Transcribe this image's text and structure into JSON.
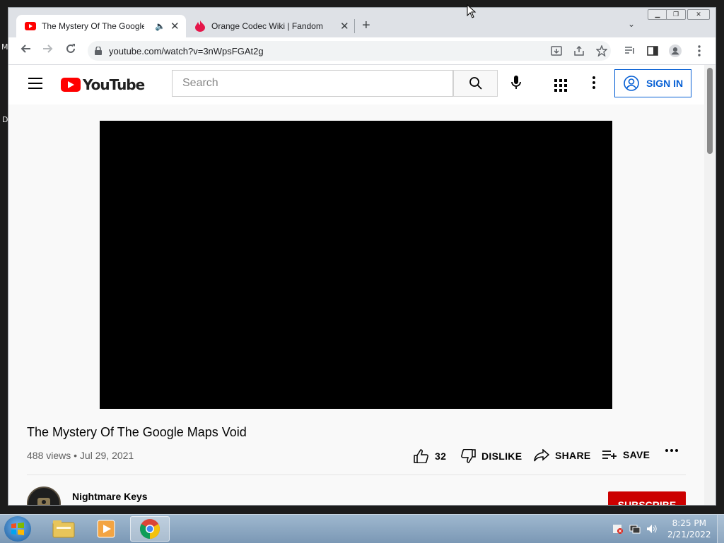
{
  "desktop": {
    "left_letters": [
      "M",
      "D"
    ]
  },
  "browser": {
    "tabs": [
      {
        "title": "The Mystery Of The Google Maps Void",
        "active": true,
        "favicon": "youtube-icon",
        "audio": true
      },
      {
        "title": "Orange Codec Wiki | Fandom",
        "active": false,
        "favicon": "fandom-icon"
      }
    ],
    "new_tab": "+",
    "url": "youtube.com/watch?v=3nWpsFGAt2g",
    "window_controls": [
      "minimize",
      "restore",
      "close"
    ]
  },
  "youtube": {
    "logo_text": "YouTube",
    "search_placeholder": "Search",
    "sign_in_label": "SIGN IN",
    "video_title": "The Mystery Of The Google Maps Void",
    "views_date": "488 views • Jul 29, 2021",
    "likes": "32",
    "dislike_label": "DISLIKE",
    "share_label": "SHARE",
    "save_label": "SAVE",
    "more_label": "...",
    "channel_name": "Nightmare Keys",
    "subscribe_label": "SUBSCRIBE",
    "accent_color": "#ff0000",
    "link_color": "#065fd4"
  },
  "taskbar": {
    "pinned": [
      "explorer-icon",
      "media-player-icon",
      "chrome-icon"
    ],
    "clock_time": "8:25 PM",
    "clock_date": "2/21/2022"
  }
}
